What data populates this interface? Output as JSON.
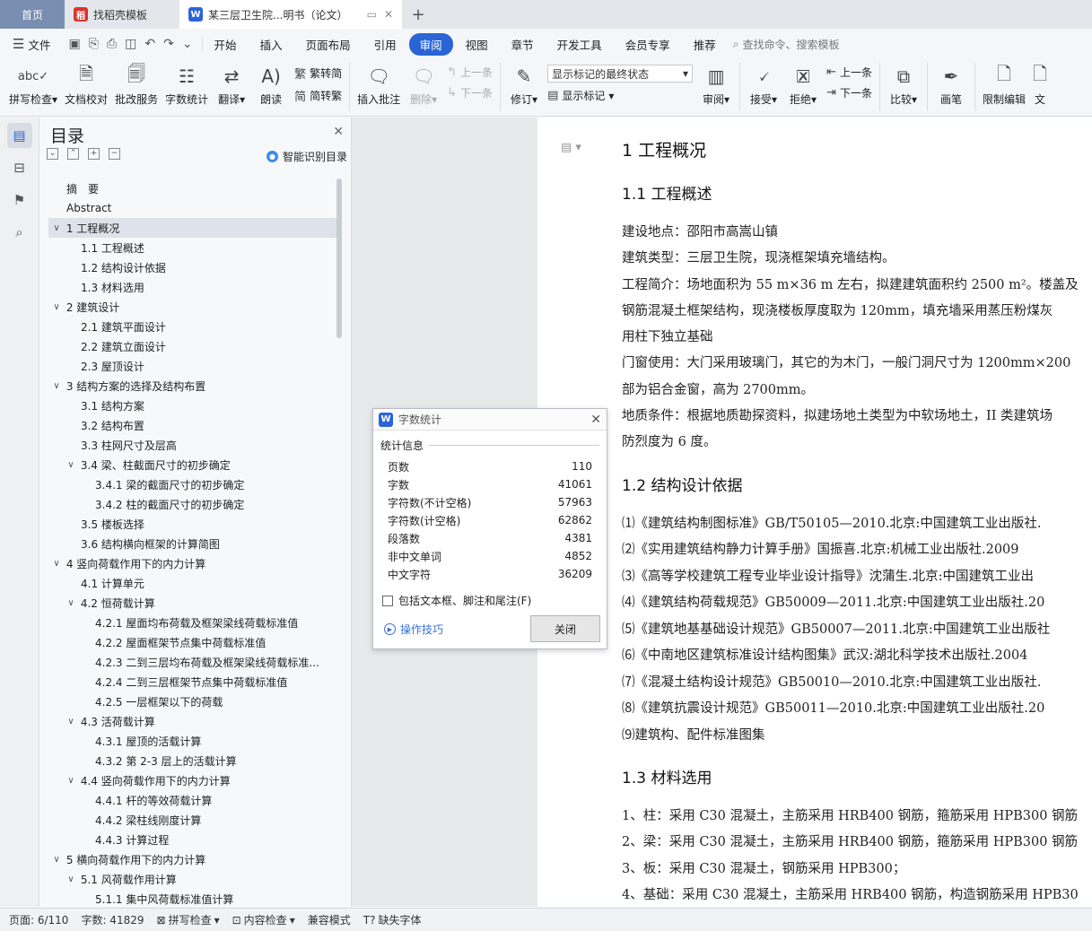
{
  "tabs": {
    "home": "首页",
    "templates": "找稻壳模板",
    "document": "某三层卫生院...明书（论文）"
  },
  "menu": {
    "file": "文件",
    "items": [
      "开始",
      "插入",
      "页面布局",
      "引用",
      "审阅",
      "视图",
      "章节",
      "开发工具",
      "会员专享",
      "推荐"
    ],
    "active": "审阅",
    "search": "查找命令、搜索模板"
  },
  "ribbon": {
    "spellcheck": "拼写检查",
    "doc_proof": "文档校对",
    "batch_service": "批改服务",
    "word_count": "字数统计",
    "translate": "翻译",
    "read_aloud": "朗读",
    "to_traditional": "繁转简",
    "to_simplified": "简转繁",
    "insert_comment": "插入批注",
    "delete": "删除",
    "prev_comment": "上一条",
    "next_comment": "下一条",
    "revise": "修订",
    "markup_state": "显示标记的最终状态",
    "show_markup": "显示标记",
    "review": "审阅",
    "accept": "接受",
    "reject": "拒绝",
    "prev_change": "上一条",
    "next_change": "下一条",
    "compare": "比较",
    "pen": "画笔",
    "restrict_edit": "限制编辑",
    "more": "文"
  },
  "toc": {
    "title": "目录",
    "smart": "智能识别目录",
    "items": [
      {
        "level": 0,
        "text": "摘　要",
        "arrow": ""
      },
      {
        "level": 0,
        "text": "Abstract",
        "arrow": ""
      },
      {
        "level": 0,
        "text": "1  工程概况",
        "arrow": "∨",
        "selected": true
      },
      {
        "level": 1,
        "text": "1.1 工程概述",
        "arrow": ""
      },
      {
        "level": 1,
        "text": "1.2 结构设计依据",
        "arrow": ""
      },
      {
        "level": 1,
        "text": "1.3 材料选用",
        "arrow": ""
      },
      {
        "level": 0,
        "text": "2  建筑设计",
        "arrow": "∨"
      },
      {
        "level": 1,
        "text": "2.1  建筑平面设计",
        "arrow": ""
      },
      {
        "level": 1,
        "text": "2.2  建筑立面设计",
        "arrow": ""
      },
      {
        "level": 1,
        "text": "2.3  屋顶设计",
        "arrow": ""
      },
      {
        "level": 0,
        "text": "3  结构方案的选择及结构布置",
        "arrow": "∨"
      },
      {
        "level": 1,
        "text": "3.1 结构方案",
        "arrow": ""
      },
      {
        "level": 1,
        "text": "3.2 结构布置",
        "arrow": ""
      },
      {
        "level": 1,
        "text": "3.3 柱网尺寸及层高",
        "arrow": ""
      },
      {
        "level": 1,
        "text": "3.4 梁、柱截面尺寸的初步确定",
        "arrow": "∨"
      },
      {
        "level": 2,
        "text": "3.4.1 梁的截面尺寸的初步确定",
        "arrow": ""
      },
      {
        "level": 2,
        "text": "3.4.2 柱的截面尺寸的初步确定",
        "arrow": ""
      },
      {
        "level": 1,
        "text": "3.5 楼板选择",
        "arrow": ""
      },
      {
        "level": 1,
        "text": "3.6 结构横向框架的计算简图",
        "arrow": ""
      },
      {
        "level": 0,
        "text": "4  竖向荷载作用下的内力计算",
        "arrow": "∨"
      },
      {
        "level": 1,
        "text": "4.1 计算单元",
        "arrow": ""
      },
      {
        "level": 1,
        "text": "4.2 恒荷载计算",
        "arrow": "∨"
      },
      {
        "level": 2,
        "text": "4.2.1 屋面均布荷载及框架梁线荷载标准值",
        "arrow": ""
      },
      {
        "level": 2,
        "text": "4.2.2 屋面框架节点集中荷载标准值",
        "arrow": ""
      },
      {
        "level": 2,
        "text": "4.2.3  二到三层均布荷载及框架梁线荷载标准...",
        "arrow": ""
      },
      {
        "level": 2,
        "text": "4.2.4 二到三层框架节点集中荷载标准值",
        "arrow": ""
      },
      {
        "level": 2,
        "text": "4.2.5 一层框架以下的荷载",
        "arrow": ""
      },
      {
        "level": 1,
        "text": "4.3 活荷载计算",
        "arrow": "∨"
      },
      {
        "level": 2,
        "text": "4.3.1 屋顶的活载计算",
        "arrow": ""
      },
      {
        "level": 2,
        "text": "4.3.2 第 2-3 层上的活载计算",
        "arrow": ""
      },
      {
        "level": 1,
        "text": "4.4 竖向荷载作用下的内力计算",
        "arrow": "∨"
      },
      {
        "level": 2,
        "text": "4.4.1 杆的等效荷载计算",
        "arrow": ""
      },
      {
        "level": 2,
        "text": "4.4.2 梁柱线刚度计算",
        "arrow": ""
      },
      {
        "level": 2,
        "text": "4.4.3 计算过程",
        "arrow": ""
      },
      {
        "level": 0,
        "text": "5  横向荷载作用下的内力计算",
        "arrow": "∨"
      },
      {
        "level": 1,
        "text": "5.1 风荷载作用计算",
        "arrow": "∨"
      },
      {
        "level": 2,
        "text": "5.1.1 集中风荷载标准值计算",
        "arrow": ""
      }
    ]
  },
  "document": {
    "h1": "1  工程概况",
    "h2_1": "1.1 工程概述",
    "paras": [
      "建设地点：邵阳市高嵩山镇",
      "建筑类型：三层卫生院，现浇框架填充墙结构。",
      "工程简介：场地面积为 55 m×36 m 左右，拟建建筑面积约 2500 m²。楼盖及",
      "钢筋混凝土框架结构，现浇楼板厚度取为 120mm，填充墙采用蒸压粉煤灰",
      "用柱下独立基础",
      "门窗使用：大门采用玻璃门，其它的为木门，一般门洞尺寸为 1200mm×200",
      "部为铝合金窗，高为 2700mm。",
      "地质条件：根据地质勘探资料，拟建场地土类型为中软场地土，II 类建筑场",
      "防烈度为 6 度。"
    ],
    "h2_2": "1.2 结构设计依据",
    "refs": [
      "⑴《建筑结构制图标准》GB/T50105—2010.北京:中国建筑工业出版社.",
      "⑵《实用建筑结构静力计算手册》国振喜.北京:机械工业出版社.2009",
      "⑶《高等学校建筑工程专业毕业设计指导》沈蒲生.北京:中国建筑工业出",
      "⑷《建筑结构荷载规范》GB50009—2011.北京:中国建筑工业出版社.20",
      "⑸《建筑地基基础设计规范》GB50007—2011.北京:中国建筑工业出版社",
      "⑹《中南地区建筑标准设计结构图集》武汉:湖北科学技术出版社.2004",
      "⑺《混凝土结构设计规范》GB50010—2010.北京:中国建筑工业出版社.",
      "⑻《建筑抗震设计规范》GB50011—2010.北京:中国建筑工业出版社.20",
      "⑼建筑构、配件标准图集"
    ],
    "h2_3": "1.3 材料选用",
    "materials": [
      "1、柱：采用 C30 混凝土，主筋采用 HRB400 钢筋，箍筋采用 HPB300 钢筋",
      "2、梁：采用 C30 混凝土，主筋采用 HRB400 钢筋，箍筋采用 HPB300 钢筋",
      "3、板：采用 C30 混凝土，钢筋采用 HPB300；",
      "4、基础：采用 C30 混凝土，主筋采用 HRB400 钢筋，构造钢筋采用 HPB30"
    ]
  },
  "dialog": {
    "title": "字数统计",
    "section": "统计信息",
    "rows": [
      {
        "label": "页数",
        "value": "110"
      },
      {
        "label": "字数",
        "value": "41061"
      },
      {
        "label": "字符数(不计空格)",
        "value": "57963"
      },
      {
        "label": "字符数(计空格)",
        "value": "62862"
      },
      {
        "label": "段落数",
        "value": "4381"
      },
      {
        "label": "非中文单词",
        "value": "4852"
      },
      {
        "label": "中文字符",
        "value": "36209"
      }
    ],
    "include_label": "包括文本框、脚注和尾注(F)",
    "tips": "操作技巧",
    "close_btn": "关闭"
  },
  "status": {
    "page": "页面: 6/110",
    "words": "字数: 41829",
    "spellcheck": "拼写检查",
    "content_check": "内容检查",
    "compat": "兼容模式",
    "missing_font": "缺失字体"
  }
}
